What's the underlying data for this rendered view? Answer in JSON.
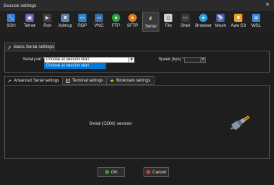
{
  "window": {
    "title": "Session settings",
    "close_glyph": "✕"
  },
  "toolbar": {
    "items": [
      {
        "label": "SSH",
        "icon": "ssh-icon",
        "glyph": "🔧",
        "color": "#3b7dd8"
      },
      {
        "label": "Telnet",
        "icon": "telnet-icon",
        "glyph": "▣",
        "color": "#7b5cc4"
      },
      {
        "label": "Rsh",
        "icon": "rsh-icon",
        "glyph": "▶",
        "color": "#404040"
      },
      {
        "label": "Xdmcp",
        "icon": "xdmcp-icon",
        "glyph": "✖",
        "color": "#5a7fb0"
      },
      {
        "label": "RDP",
        "icon": "rdp-icon",
        "glyph": "▭",
        "color": "#2a84c8"
      },
      {
        "label": "VNC",
        "icon": "vnc-icon",
        "glyph": "▭",
        "color": "#3a6aa8"
      },
      {
        "label": "FTP",
        "icon": "ftp-icon",
        "glyph": "●",
        "color": "#2ea043"
      },
      {
        "label": "SFTP",
        "icon": "sftp-icon",
        "glyph": "●",
        "color": "#e07b1a"
      },
      {
        "label": "Serial",
        "icon": "serial-icon",
        "glyph": "⚡",
        "color": "#8aa0b4"
      },
      {
        "label": "File",
        "icon": "file-icon",
        "glyph": "▯",
        "color": "#cfcfcf"
      },
      {
        "label": "Shell",
        "icon": "shell-icon",
        "glyph": "▭",
        "color": "#3a3a3a"
      },
      {
        "label": "Browser",
        "icon": "browser-icon",
        "glyph": "●",
        "color": "#2f9fd8"
      },
      {
        "label": "Mosh",
        "icon": "mosh-icon",
        "glyph": "📡",
        "color": "#4a5fb0"
      },
      {
        "label": "Aws S3",
        "icon": "aws-s3-icon",
        "glyph": "✱",
        "color": "#e8a020"
      },
      {
        "label": "WSL",
        "icon": "wsl-icon",
        "glyph": "⊞",
        "color": "#3a86d4"
      }
    ],
    "selected": "Serial"
  },
  "basic": {
    "tab_label": "Basic Serial settings",
    "serial_port_label": "Serial port *",
    "serial_port_value": "Choose at session start",
    "serial_port_option": "Choose at session start",
    "speed_label": "Speed (bps) *",
    "speed_value": ""
  },
  "tabs": [
    {
      "label": "Advanced Serial settings",
      "active": true
    },
    {
      "label": "Terminal settings",
      "active": false
    },
    {
      "label": "Bookmark settings",
      "active": false
    }
  ],
  "panel": {
    "session_text": "Serial (COM) session"
  },
  "buttons": {
    "ok_label": "OK",
    "cancel_label": "Cancel"
  },
  "colors": {
    "accent": "#0078d7",
    "ok": "#2ea043",
    "cancel": "#d73a3a"
  }
}
